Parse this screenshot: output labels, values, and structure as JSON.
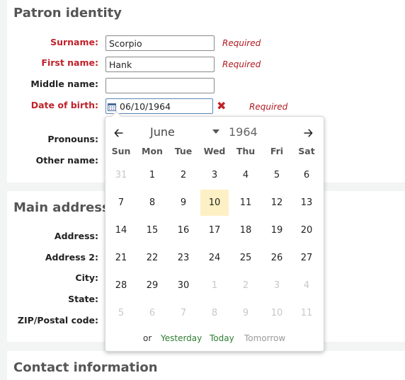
{
  "patron_identity": {
    "title": "Patron identity",
    "surname": {
      "label": "Surname:",
      "value": "Scorpio",
      "required": "Required"
    },
    "first_name": {
      "label": "First name:",
      "value": "Hank",
      "required": "Required"
    },
    "middle_name": {
      "label": "Middle name:",
      "value": ""
    },
    "date_of_birth": {
      "label": "Date of birth:",
      "value": "06/10/1964",
      "required": "Required"
    },
    "pronouns": {
      "label": "Pronouns:"
    },
    "other_name": {
      "label": "Other name:"
    }
  },
  "main_address": {
    "title": "Main address",
    "address": {
      "label": "Address:"
    },
    "address2": {
      "label": "Address 2:"
    },
    "city": {
      "label": "City:"
    },
    "state": {
      "label": "State:"
    },
    "zip": {
      "label": "ZIP/Postal code:"
    }
  },
  "contact_information": {
    "title": "Contact information"
  },
  "datepicker": {
    "prev_icon": "arrow-left-icon",
    "next_icon": "arrow-right-icon",
    "month": "June",
    "year": "1964",
    "weekdays": [
      "Sun",
      "Mon",
      "Tue",
      "Wed",
      "Thu",
      "Fri",
      "Sat"
    ],
    "weeks": [
      [
        "31",
        "1",
        "2",
        "3",
        "4",
        "5",
        "6"
      ],
      [
        "7",
        "8",
        "9",
        "10",
        "11",
        "12",
        "13"
      ],
      [
        "14",
        "15",
        "16",
        "17",
        "18",
        "19",
        "20"
      ],
      [
        "21",
        "22",
        "23",
        "24",
        "25",
        "26",
        "27"
      ],
      [
        "28",
        "29",
        "30",
        "1",
        "2",
        "3",
        "4"
      ],
      [
        "5",
        "6",
        "7",
        "8",
        "9",
        "10",
        "11"
      ]
    ],
    "selected_day": "10",
    "quick_or": "or",
    "quick_yesterday": "Yesterday",
    "quick_today": "Today",
    "quick_tomorrow": "Tomorrow"
  },
  "colors": {
    "required": "#c0222a",
    "selected_day_bg": "#fdf0c4",
    "quick_link": "#2e7d32"
  }
}
